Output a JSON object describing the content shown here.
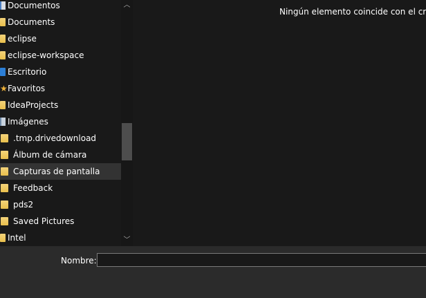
{
  "nav": {
    "items": [
      {
        "label": "Documentos",
        "icon": "document-icon"
      },
      {
        "label": "Documents",
        "icon": "folder-icon"
      },
      {
        "label": "eclipse",
        "icon": "folder-icon"
      },
      {
        "label": "eclipse-workspace",
        "icon": "folder-icon"
      },
      {
        "label": "Escritorio",
        "icon": "desktop-icon"
      },
      {
        "label": "Favoritos",
        "icon": "star-icon"
      },
      {
        "label": "IdeaProjects",
        "icon": "folder-icon"
      },
      {
        "label": "Imágenes",
        "icon": "images-icon"
      },
      {
        "label": ".tmp.drivedownload",
        "icon": "folder-icon"
      },
      {
        "label": "Álbum de cámara",
        "icon": "folder-icon"
      },
      {
        "label": "Capturas de pantalla",
        "icon": "folder-icon"
      },
      {
        "label": "Feedback",
        "icon": "folder-icon"
      },
      {
        "label": "pds2",
        "icon": "folder-icon"
      },
      {
        "label": "Saved Pictures",
        "icon": "folder-icon"
      },
      {
        "label": "Intel",
        "icon": "folder-icon"
      }
    ]
  },
  "content": {
    "empty_message": "Ningún elemento coincide con el criterio"
  },
  "bottom": {
    "name_label": "Nombre:",
    "name_value": ""
  },
  "colors": {
    "background": "#191919",
    "selected_row": "#333333",
    "bottom_bar": "#2b2b2b",
    "folder": "#f3d37a"
  }
}
